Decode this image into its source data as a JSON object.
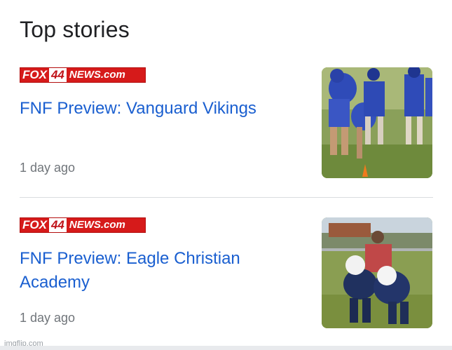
{
  "section": {
    "heading": "Top stories"
  },
  "stories": [
    {
      "source_logo": {
        "fox": "FOX",
        "number": "44",
        "news": "NEWS.com"
      },
      "title": "FNF Preview: Vanguard Vikings",
      "time": "1 day ago"
    },
    {
      "source_logo": {
        "fox": "FOX",
        "number": "44",
        "news": "NEWS.com"
      },
      "title": "FNF Preview: Eagle Christian Academy",
      "time": "1 day ago"
    }
  ],
  "watermark": "imgflip.com",
  "colors": {
    "link": "#1a5fd0",
    "secondary_text": "#70757a",
    "logo_red": "#d61a1a",
    "divider": "#dadce0"
  }
}
